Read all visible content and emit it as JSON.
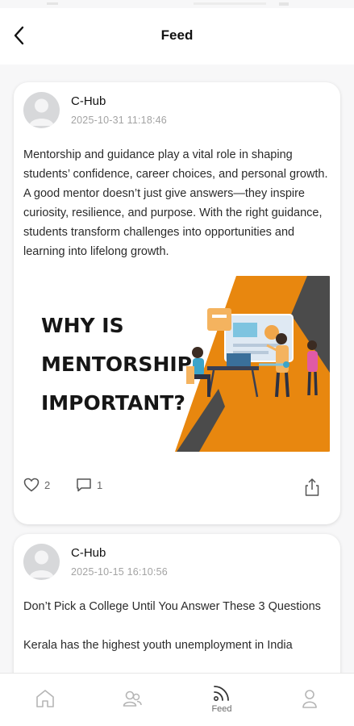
{
  "header": {
    "title": "Feed"
  },
  "posts": [
    {
      "author": "C-Hub",
      "timestamp": "2025-10-31 11:18:46",
      "text": "Mentorship and guidance play a vital role in shaping students’ confidence, career choices, and personal growth. A good mentor doesn’t just give answers—they inspire curiosity, resilience, and purpose. With the right guidance, students transform challenges into opportunities and learning into lifelong growth.",
      "image": {
        "line1": "WHY IS",
        "line2": "MENTORSHIP",
        "line3": "IMPORTANT?",
        "colors": {
          "orange": "#e8870f",
          "dark": "#4b4b4b"
        }
      },
      "likes": "2",
      "comments": "1"
    },
    {
      "author": "C-Hub",
      "timestamp": "2025-10-15 16:10:56",
      "paragraph1": "Don’t Pick a College Until You Answer These 3 Questions",
      "paragraph2": "Kerala has the highest youth unemployment in India"
    }
  ],
  "nav": {
    "items": [
      {
        "icon": "home-icon",
        "label": ""
      },
      {
        "icon": "people-icon",
        "label": ""
      },
      {
        "icon": "feed-icon",
        "label": "Feed"
      },
      {
        "icon": "profile-icon",
        "label": ""
      }
    ]
  }
}
